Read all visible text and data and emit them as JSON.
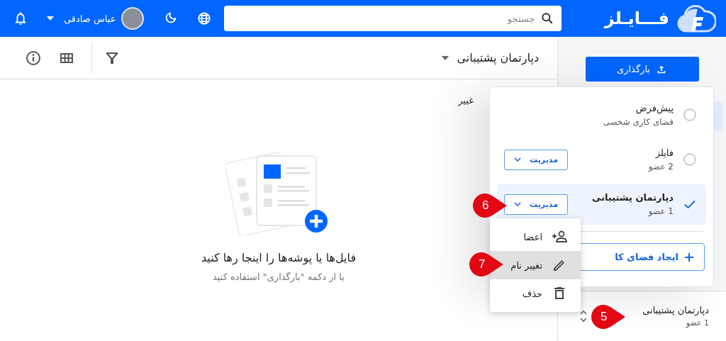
{
  "header": {
    "logo": "فـــایـلز",
    "search": {
      "placeholder": "جستجو"
    },
    "user": {
      "name": "عباس صادقی"
    }
  },
  "toolbar": {
    "folder_title": "دپارتمان پشتیبانی"
  },
  "file_list": {
    "column_1": "غییر"
  },
  "empty_state": {
    "title": "فایل‌ها یا پوشه‌ها را اینجا رها کنید",
    "subtitle": "یا از دکمه \"بارگذاری\" استفاده کنید"
  },
  "sidebar": {
    "upload_button": "بارگذاری",
    "current_workspace": {
      "name": "دپارتمان پشتیبانی",
      "members": "1 عضو",
      "annotation": "5"
    }
  },
  "workspace_menu": {
    "workspaces": [
      {
        "name": "پیش‌فرض",
        "subtitle": "فضای کاری شخصی",
        "selected": false
      },
      {
        "name": "فایلز",
        "subtitle": "2 عضو",
        "selected": false,
        "manage": "مدیریت"
      },
      {
        "name": "دپارتمان پشتیبانی",
        "subtitle": "1 عضو",
        "selected": true,
        "manage": "مدیریت",
        "annotation": "6"
      }
    ],
    "create_button": "ایجاد فضای کا"
  },
  "context_menu": {
    "items": [
      {
        "label": "اعضا",
        "kind": "members",
        "selected": false
      },
      {
        "label": "تغییر نام",
        "kind": "rename",
        "selected": true,
        "annotation": "7"
      },
      {
        "label": "حذف",
        "kind": "delete",
        "selected": false
      }
    ]
  }
}
